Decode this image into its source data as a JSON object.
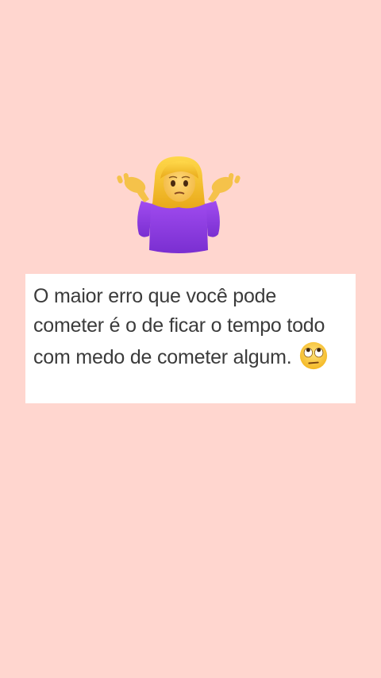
{
  "background_color": "#ffd6cf",
  "top_emoji": {
    "icon": "person-shrugging-icon"
  },
  "quote": {
    "text": "O maior erro que você pode cometer é o de ficar o tempo todo com medo de cometer algum.",
    "trailing_emoji": "face-with-rolling-eyes-icon"
  }
}
